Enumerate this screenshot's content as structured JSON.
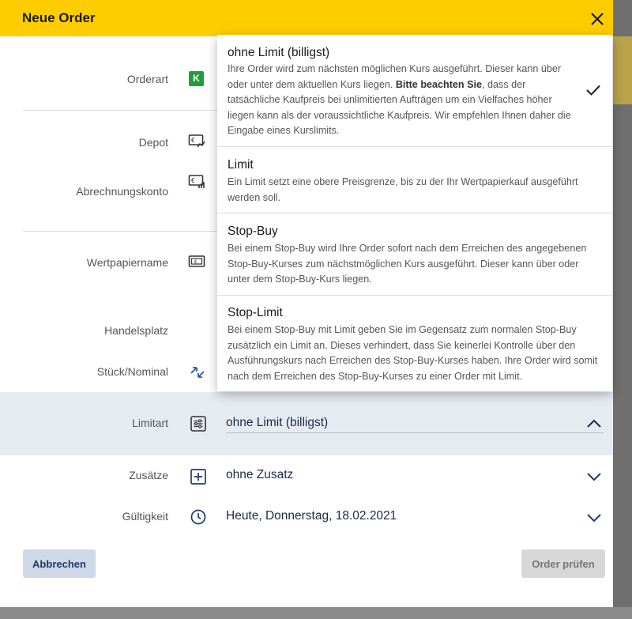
{
  "dialog": {
    "title": "Neue Order",
    "fields": {
      "orderart_label": "Orderart",
      "orderart_badge": "K",
      "depot_label": "Depot",
      "abrechnungskonto_label": "Abrechnungskonto",
      "wertpapiername_label": "Wertpapiername",
      "handelsplatz_label": "Handelsplatz",
      "stueck_label": "Stück/Nominal",
      "limitart_label": "Limitart",
      "limitart_value": "ohne Limit (billigst)",
      "zusaetze_label": "Zusätze",
      "zusaetze_value": "ohne Zusatz",
      "gueltigkeit_label": "Gültigkeit",
      "gueltigkeit_value": "Heute, Donnerstag, 18.02.2021"
    },
    "buttons": {
      "cancel": "Abbrechen",
      "check": "Order prüfen"
    }
  },
  "limit_menu": {
    "items": [
      {
        "title": "ohne Limit (billigst)",
        "desc_part1": "Ihre Order wird zum nächsten möglichen Kurs ausgeführt. Dieser kann über oder unter dem aktuellen Kurs liegen. ",
        "desc_bold": "Bitte beachten Sie",
        "desc_part2": ", dass der tatsächliche Kaufpreis bei unlimitierten Aufträgen um ein Vielfaches höher liegen kann als der voraussichtliche Kaufpreis. Wir empfehlen Ihnen daher die Eingabe eines Kurslimits.",
        "selected": true
      },
      {
        "title": "Limit",
        "desc": "Ein Limit setzt eine obere Preisgrenze, bis zu der Ihr Wertpapierkauf ausgeführt werden soll."
      },
      {
        "title": "Stop-Buy",
        "desc": "Bei einem Stop-Buy wird Ihre Order sofort nach dem Erreichen des angegebenen Stop-Buy-Kurses zum nächstmöglichen Kurs ausgeführt. Dieser kann über oder unter dem Stop-Buy-Kurs liegen."
      },
      {
        "title": "Stop-Limit",
        "desc": "Bei einem Stop-Buy mit Limit geben Sie im Gegensatz zum normalen Stop-Buy zusätzlich ein Limit an. Dieses verhindert, dass Sie keinerlei Kontrolle über den Ausführungskurs nach Erreichen des Stop-Buy-Kurses haben. Ihre Order wird somit nach dem Erreichen des Stop-Buy-Kurses zu einer Order mit Limit."
      }
    ]
  },
  "colors": {
    "header": "#ffcc00",
    "accent_navy": "#1f3b6b",
    "limit_band": "#e6ebf2"
  }
}
